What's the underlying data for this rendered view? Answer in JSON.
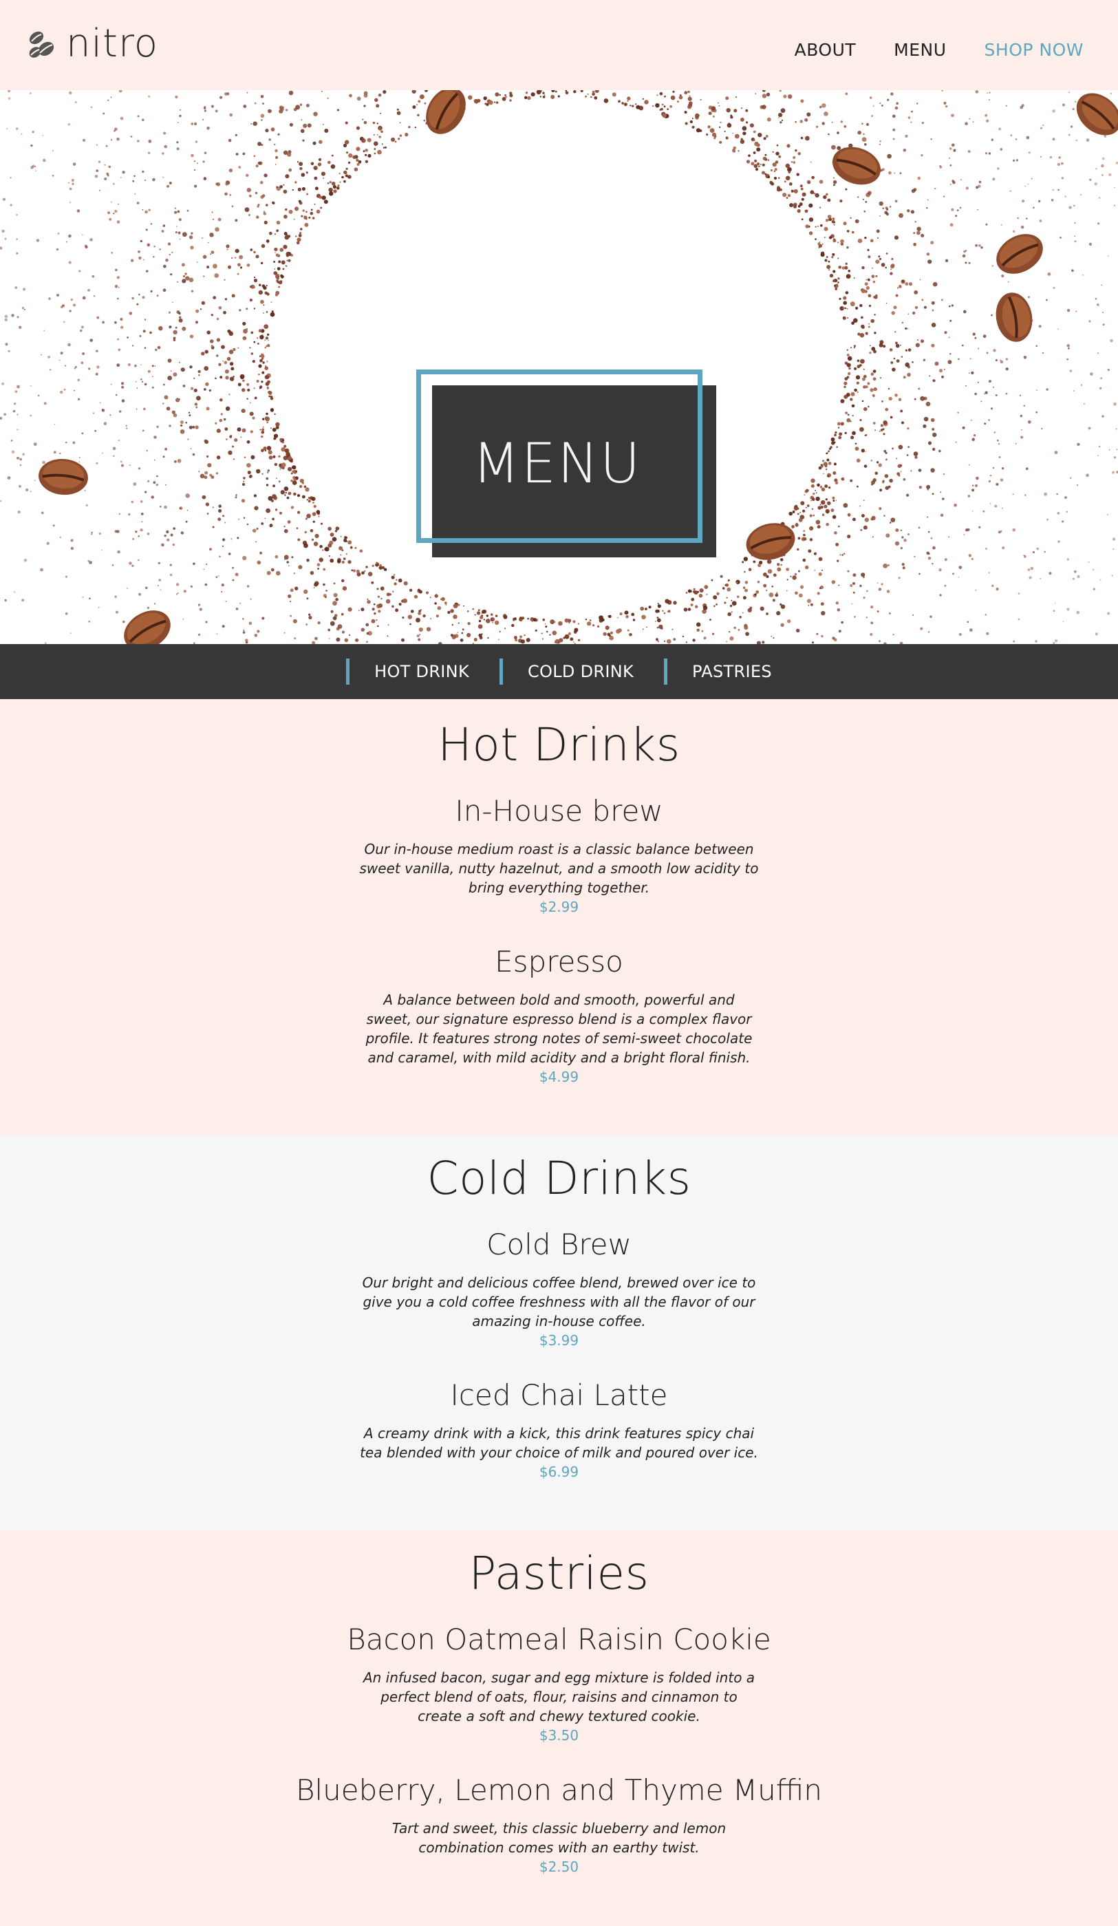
{
  "header": {
    "brand": "nitro",
    "nav": [
      "ABOUT",
      "MENU",
      "SHOP NOW"
    ]
  },
  "hero": {
    "title": "MENU"
  },
  "categories": [
    "HOT DRINK",
    "COLD DRINK",
    "PASTRIES"
  ],
  "sections": [
    {
      "title": "Hot Drinks",
      "items": [
        {
          "name": "In-House brew",
          "desc": "Our in-house medium roast is a classic balance between sweet vanilla, nutty hazelnut, and a smooth low acidity to bring everything together.",
          "price": "$2.99"
        },
        {
          "name": "Espresso",
          "desc": "A balance between bold and smooth, powerful and sweet, our signature espresso blend is a complex flavor profile. It features strong notes of semi-sweet chocolate and caramel, with mild acidity and a bright floral finish.",
          "price": "$4.99"
        }
      ]
    },
    {
      "title": "Cold Drinks",
      "items": [
        {
          "name": "Cold Brew",
          "desc": "Our bright and delicious coffee blend, brewed over ice to give you a cold coffee freshness with all the flavor of our amazing in-house coffee.",
          "price": "$3.99"
        },
        {
          "name": "Iced Chai Latte",
          "desc": "A creamy drink with a kick, this drink features spicy chai tea blended with your choice of milk and poured over ice.",
          "price": "$6.99"
        }
      ]
    },
    {
      "title": "Pastries",
      "items": [
        {
          "name": "Bacon Oatmeal Raisin Cookie",
          "desc": "An infused bacon, sugar and egg mixture is folded into a perfect blend of oats, flour, raisins and cinnamon to create a soft and chewy textured cookie.",
          "price": "$3.50"
        },
        {
          "name": "Blueberry, Lemon and Thyme Muffin",
          "desc": "Tart and sweet, this classic blueberry and lemon combination comes with an earthy twist.",
          "price": "$2.50"
        }
      ]
    }
  ],
  "colors": {
    "accent": "#5ea6bf",
    "dark": "#373737",
    "blush": "#fdeeea",
    "light_gray": "#f6f6f6",
    "coffee": "#7a3b28"
  }
}
